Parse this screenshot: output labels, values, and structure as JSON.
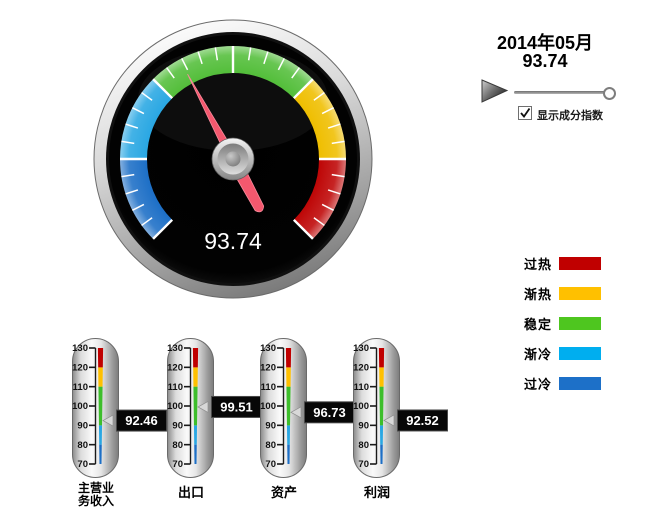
{
  "gauge": {
    "value": 93.74,
    "value_display": "93.74",
    "min": 70,
    "max": 130,
    "sweep_deg": 270,
    "bands": [
      {
        "label": "过冷",
        "from": 70,
        "to": 80,
        "color": "#1d6fc6"
      },
      {
        "label": "渐冷",
        "from": 80,
        "to": 90,
        "color": "#29a7e3"
      },
      {
        "label": "稳定",
        "from": 90,
        "to": 110,
        "color": "#53be3a"
      },
      {
        "label": "渐热",
        "from": 110,
        "to": 120,
        "color": "#efbe00"
      },
      {
        "label": "过热",
        "from": 120,
        "to": 130,
        "color": "#be0606"
      }
    ],
    "needle_color": "#f4586e"
  },
  "player": {
    "date_label": "2014年05月",
    "value_label": "93.74",
    "checkbox_label": "显示成分指数",
    "checkbox_checked": true
  },
  "legend": {
    "items": [
      {
        "label": "过热",
        "color": "#c00000"
      },
      {
        "label": "渐热",
        "color": "#ffc000"
      },
      {
        "label": "稳定",
        "color": "#4ec61f"
      },
      {
        "label": "渐冷",
        "color": "#00aeef"
      },
      {
        "label": "过冷",
        "color": "#1d70c8"
      }
    ]
  },
  "thermometers": {
    "min": 70,
    "max": 130,
    "tick_labels": [
      "130",
      "120",
      "110",
      "100",
      "90",
      "80",
      "70"
    ],
    "bands": [
      {
        "from": 70,
        "to": 80,
        "color": "#1d6fc6"
      },
      {
        "from": 80,
        "to": 90,
        "color": "#29a7e3"
      },
      {
        "from": 90,
        "to": 110,
        "color": "#3dbe2b"
      },
      {
        "from": 110,
        "to": 120,
        "color": "#ffc000"
      },
      {
        "from": 120,
        "to": 130,
        "color": "#c00000"
      }
    ],
    "items": [
      {
        "label": "主营业\n务收入",
        "value": 92.46,
        "display": "92.46"
      },
      {
        "label": "出口",
        "value": 99.51,
        "display": "99.51"
      },
      {
        "label": "资产",
        "value": 96.73,
        "display": "96.73"
      },
      {
        "label": "利润",
        "value": 92.52,
        "display": "92.52"
      }
    ]
  },
  "chart_data": [
    {
      "type": "gauge",
      "value": 93.74,
      "min": 70,
      "max": 130,
      "period": "2014年05月",
      "bands": [
        {
          "label": "过冷",
          "range": [
            70,
            80
          ]
        },
        {
          "label": "渐冷",
          "range": [
            80,
            90
          ]
        },
        {
          "label": "稳定",
          "range": [
            90,
            110
          ]
        },
        {
          "label": "渐热",
          "range": [
            110,
            120
          ]
        },
        {
          "label": "过热",
          "range": [
            120,
            130
          ]
        }
      ]
    },
    {
      "type": "thermometer",
      "categories": [
        "主营业务收入",
        "出口",
        "资产",
        "利润"
      ],
      "values": [
        92.46,
        99.51,
        96.73,
        92.52
      ],
      "ylim": [
        70,
        130
      ],
      "tick_step": 10,
      "legend": [
        "过热",
        "渐热",
        "稳定",
        "渐冷",
        "过冷"
      ]
    }
  ]
}
